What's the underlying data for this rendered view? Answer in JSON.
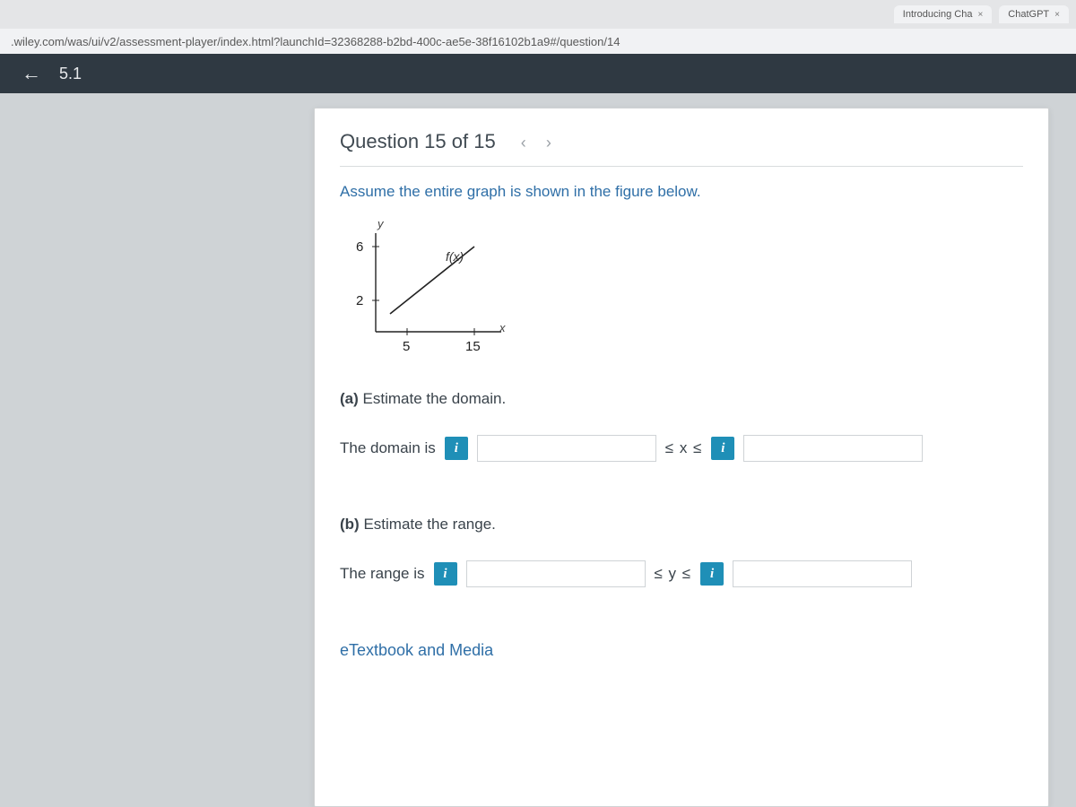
{
  "browser": {
    "tabs": [
      {
        "title": "Introducing Cha",
        "close": "×"
      },
      {
        "title": "ChatGPT",
        "close": "×"
      }
    ],
    "url": ".wiley.com/was/ui/v2/assessment-player/index.html?launchId=32368288-b2bd-400c-ae5e-38f16102b1a9#/question/14"
  },
  "section_bar": {
    "back_glyph": "←",
    "label": "5.1"
  },
  "question": {
    "header": "Question 15 of 15",
    "nav_prev": "‹",
    "nav_next": "›",
    "prompt": "Assume the entire graph is shown in the figure below.",
    "graph": {
      "y_label": "y",
      "x_label": "x",
      "fn_label": "f(x)",
      "y_ticks": [
        "6",
        "2"
      ],
      "x_ticks": [
        "5",
        "15"
      ]
    },
    "part_a": {
      "tag": "(a)",
      "text": "Estimate the domain.",
      "lead": "The domain is",
      "between": "≤ x ≤"
    },
    "part_b": {
      "tag": "(b)",
      "text": "Estimate the range.",
      "lead": "The range is",
      "between": "≤ y ≤"
    },
    "info_glyph": "i",
    "etext_link": "eTextbook and Media"
  },
  "chart_data": {
    "type": "line",
    "x": [
      5,
      15
    ],
    "y": [
      2,
      6
    ],
    "xlabel": "x",
    "ylabel": "y",
    "series_label": "f(x)",
    "x_ticks": [
      5,
      15
    ],
    "y_ticks": [
      2,
      6
    ],
    "xlim": [
      0,
      16
    ],
    "ylim": [
      0,
      7
    ]
  }
}
